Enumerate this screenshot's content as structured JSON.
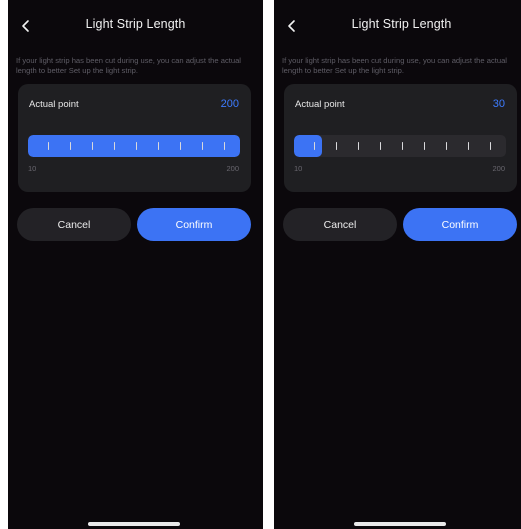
{
  "screens": [
    {
      "title": "Light Strip Length",
      "description": "If your light strip has been cut during use, you can adjust the actual length to better Set up the light strip.",
      "card": {
        "label": "Actual point",
        "value": "200",
        "slider_min": "10",
        "slider_max": "200",
        "slider_fraction": 1.0
      },
      "cancel_label": "Cancel",
      "confirm_label": "Confirm",
      "icons": {
        "back": "chevron-left-icon"
      }
    },
    {
      "title": "Light Strip Length",
      "description": "If your light strip has been cut during use, you can adjust the actual length to better Set up the light strip.",
      "card": {
        "label": "Actual point",
        "value": "30",
        "slider_min": "10",
        "slider_max": "200",
        "slider_fraction": 0.13
      },
      "cancel_label": "Cancel",
      "confirm_label": "Confirm",
      "icons": {
        "back": "chevron-left-icon"
      }
    }
  ],
  "colors": {
    "background": "#0b080c",
    "card": "#1f1f22",
    "accent": "#3c73f4",
    "value_text": "#3d7bff",
    "muted_text": "#5f5d66"
  }
}
